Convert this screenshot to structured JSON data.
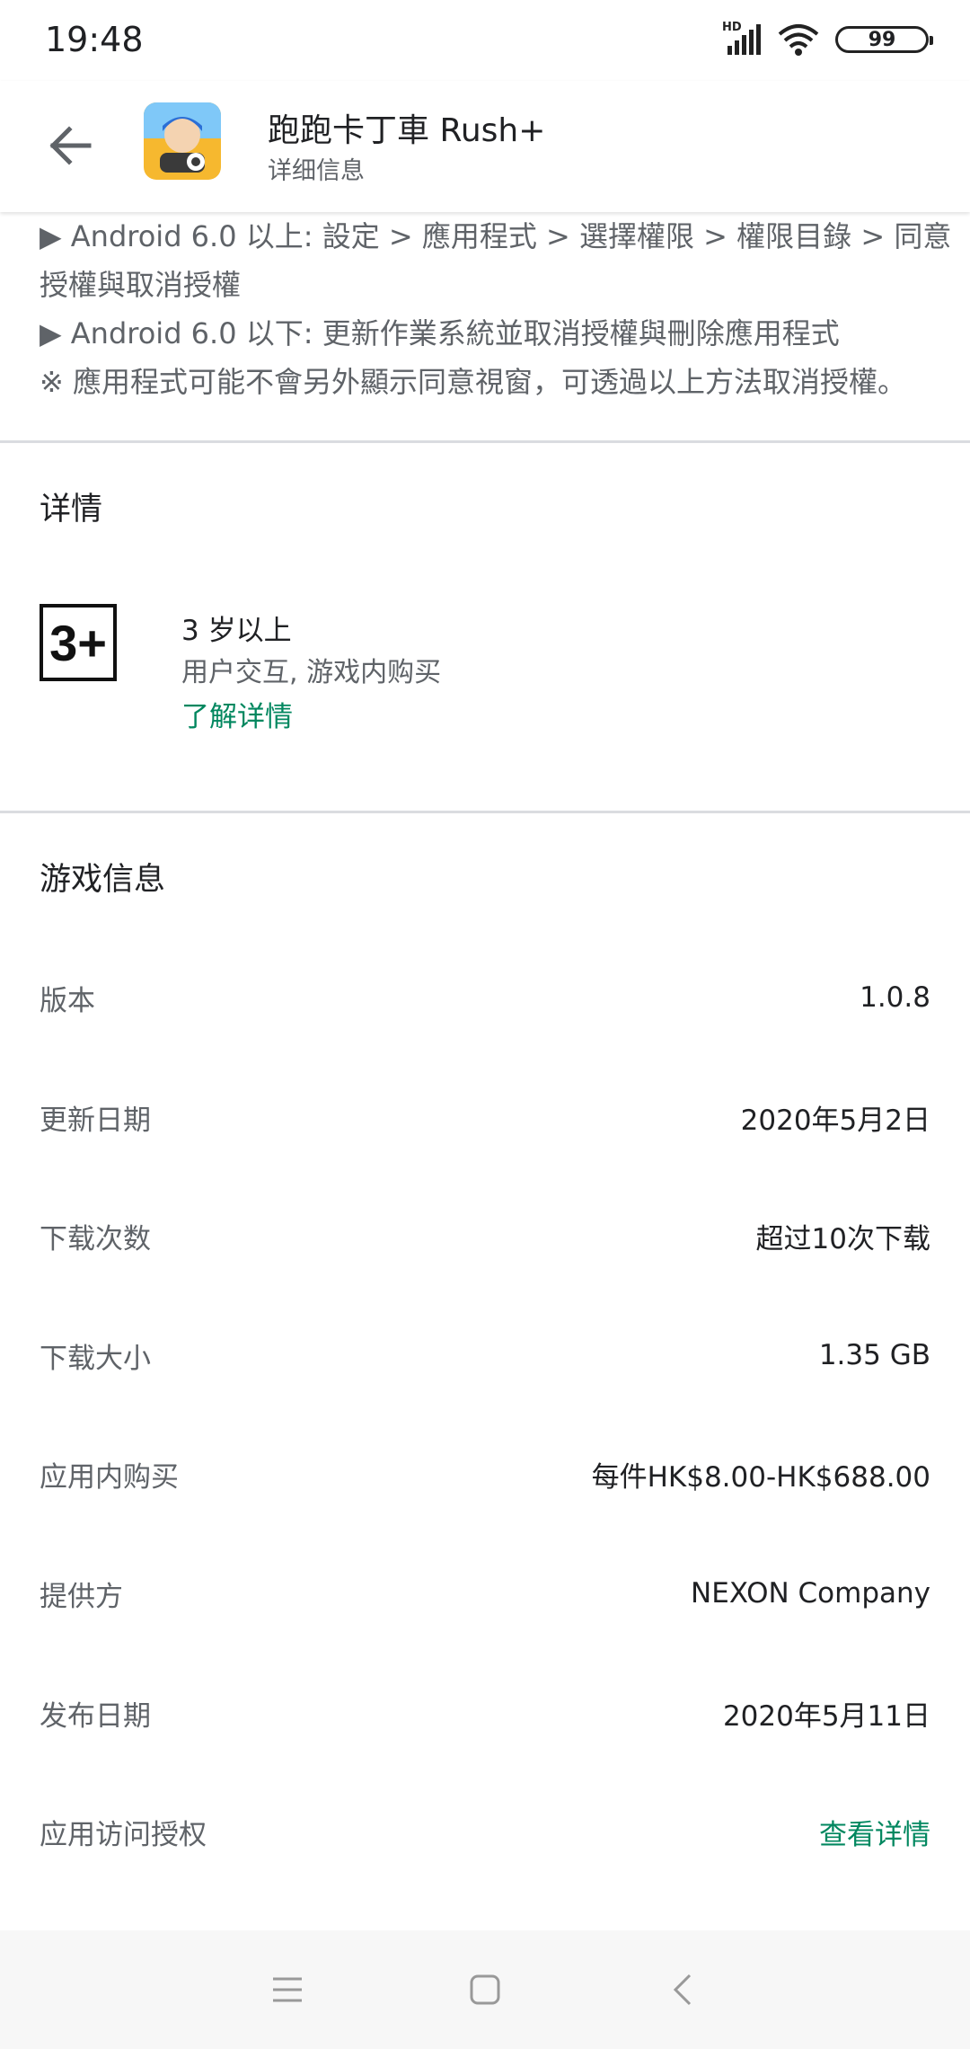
{
  "status_bar": {
    "time": "19:48",
    "network_label": "HD",
    "battery": "99"
  },
  "header": {
    "app_name": "跑跑卡丁車 Rush+",
    "subtitle": "详细信息",
    "icons": {
      "back": "arrow-left-icon",
      "app": "app-icon"
    }
  },
  "permissions": {
    "lines": [
      "▶ Android 6.0 以上: 設定 > 應用程式 > 選擇權限 > 權限目錄 > 同意",
      "授權與取消授權",
      "▶ Android 6.0 以下: 更新作業系統並取消授權與刪除應用程式",
      "※ 應用程式可能不會另外顯示同意視窗，可透過以上方法取消授權。"
    ]
  },
  "rating_section": {
    "title": "详情",
    "badge": "3+",
    "age": "3 岁以上",
    "descriptors": "用户交互, 游戏内购买",
    "learn_more": "了解详情"
  },
  "game_info": {
    "title": "游戏信息",
    "rows": [
      {
        "label": "版本",
        "value": "1.0.8"
      },
      {
        "label": "更新日期",
        "value": "2020年5月2日"
      },
      {
        "label": "下载次数",
        "value": "超过10次下载"
      },
      {
        "label": "下载大小",
        "value": "1.35 GB"
      },
      {
        "label": "应用内购买",
        "value": "每件HK$8.00-HK$688.00"
      },
      {
        "label": "提供方",
        "value": "NEXON Company"
      },
      {
        "label": "发布日期",
        "value": "2020年5月11日"
      },
      {
        "label": "应用访问授权",
        "value": "查看详情"
      }
    ]
  },
  "colors": {
    "accent_green": "#01875f",
    "text_primary": "#202124",
    "text_secondary": "#5f6368",
    "divider": "#dadce0"
  },
  "nav_bar": {
    "icons": [
      "menu-icon",
      "home-icon",
      "back-icon"
    ]
  }
}
